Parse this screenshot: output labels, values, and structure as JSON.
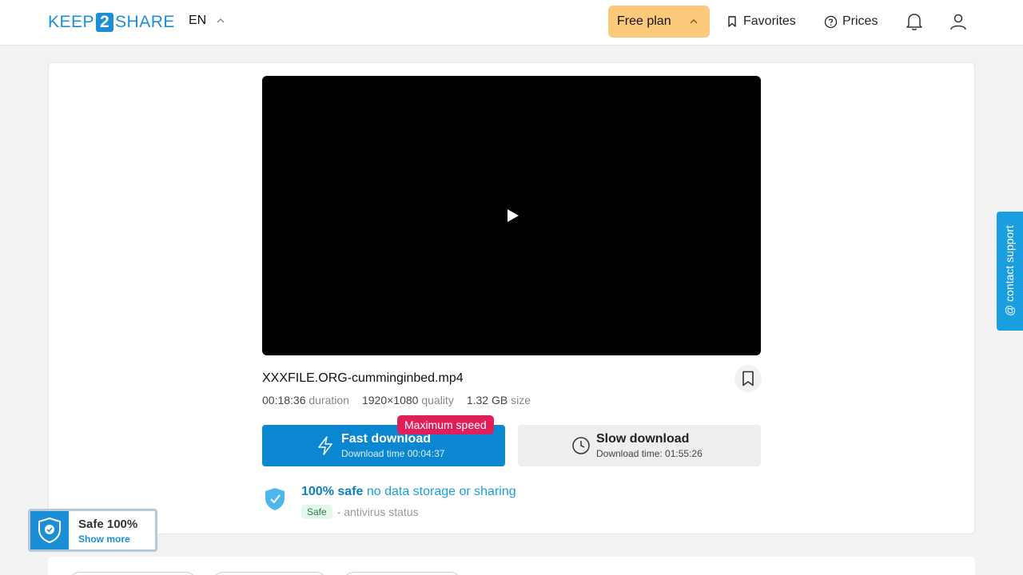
{
  "header": {
    "logo_left": "KEEP",
    "logo_num": "2",
    "logo_right": "SHARE",
    "lang": "EN",
    "plan": "Free plan",
    "favorites": "Favorites",
    "prices": "Prices"
  },
  "file": {
    "name": "XXXFILE.ORG-cumminginbed.mp4",
    "duration": "00:18:36",
    "duration_label": "duration",
    "quality": "1920×1080",
    "quality_label": "quality",
    "size": "1.32 GB",
    "size_label": "size"
  },
  "download": {
    "badge": "Maximum speed",
    "fast_title": "Fast download",
    "fast_time": "Download time 00:04:37",
    "slow_title": "Slow download",
    "slow_time": "Download time: 01:55:26"
  },
  "safety": {
    "bold": "100% safe",
    "rest": "no data storage or sharing",
    "status_badge": "Safe",
    "status_text": "- antivirus status"
  },
  "support": "@ contact support",
  "widget": {
    "title": "Safe 100%",
    "link": "Show more"
  }
}
